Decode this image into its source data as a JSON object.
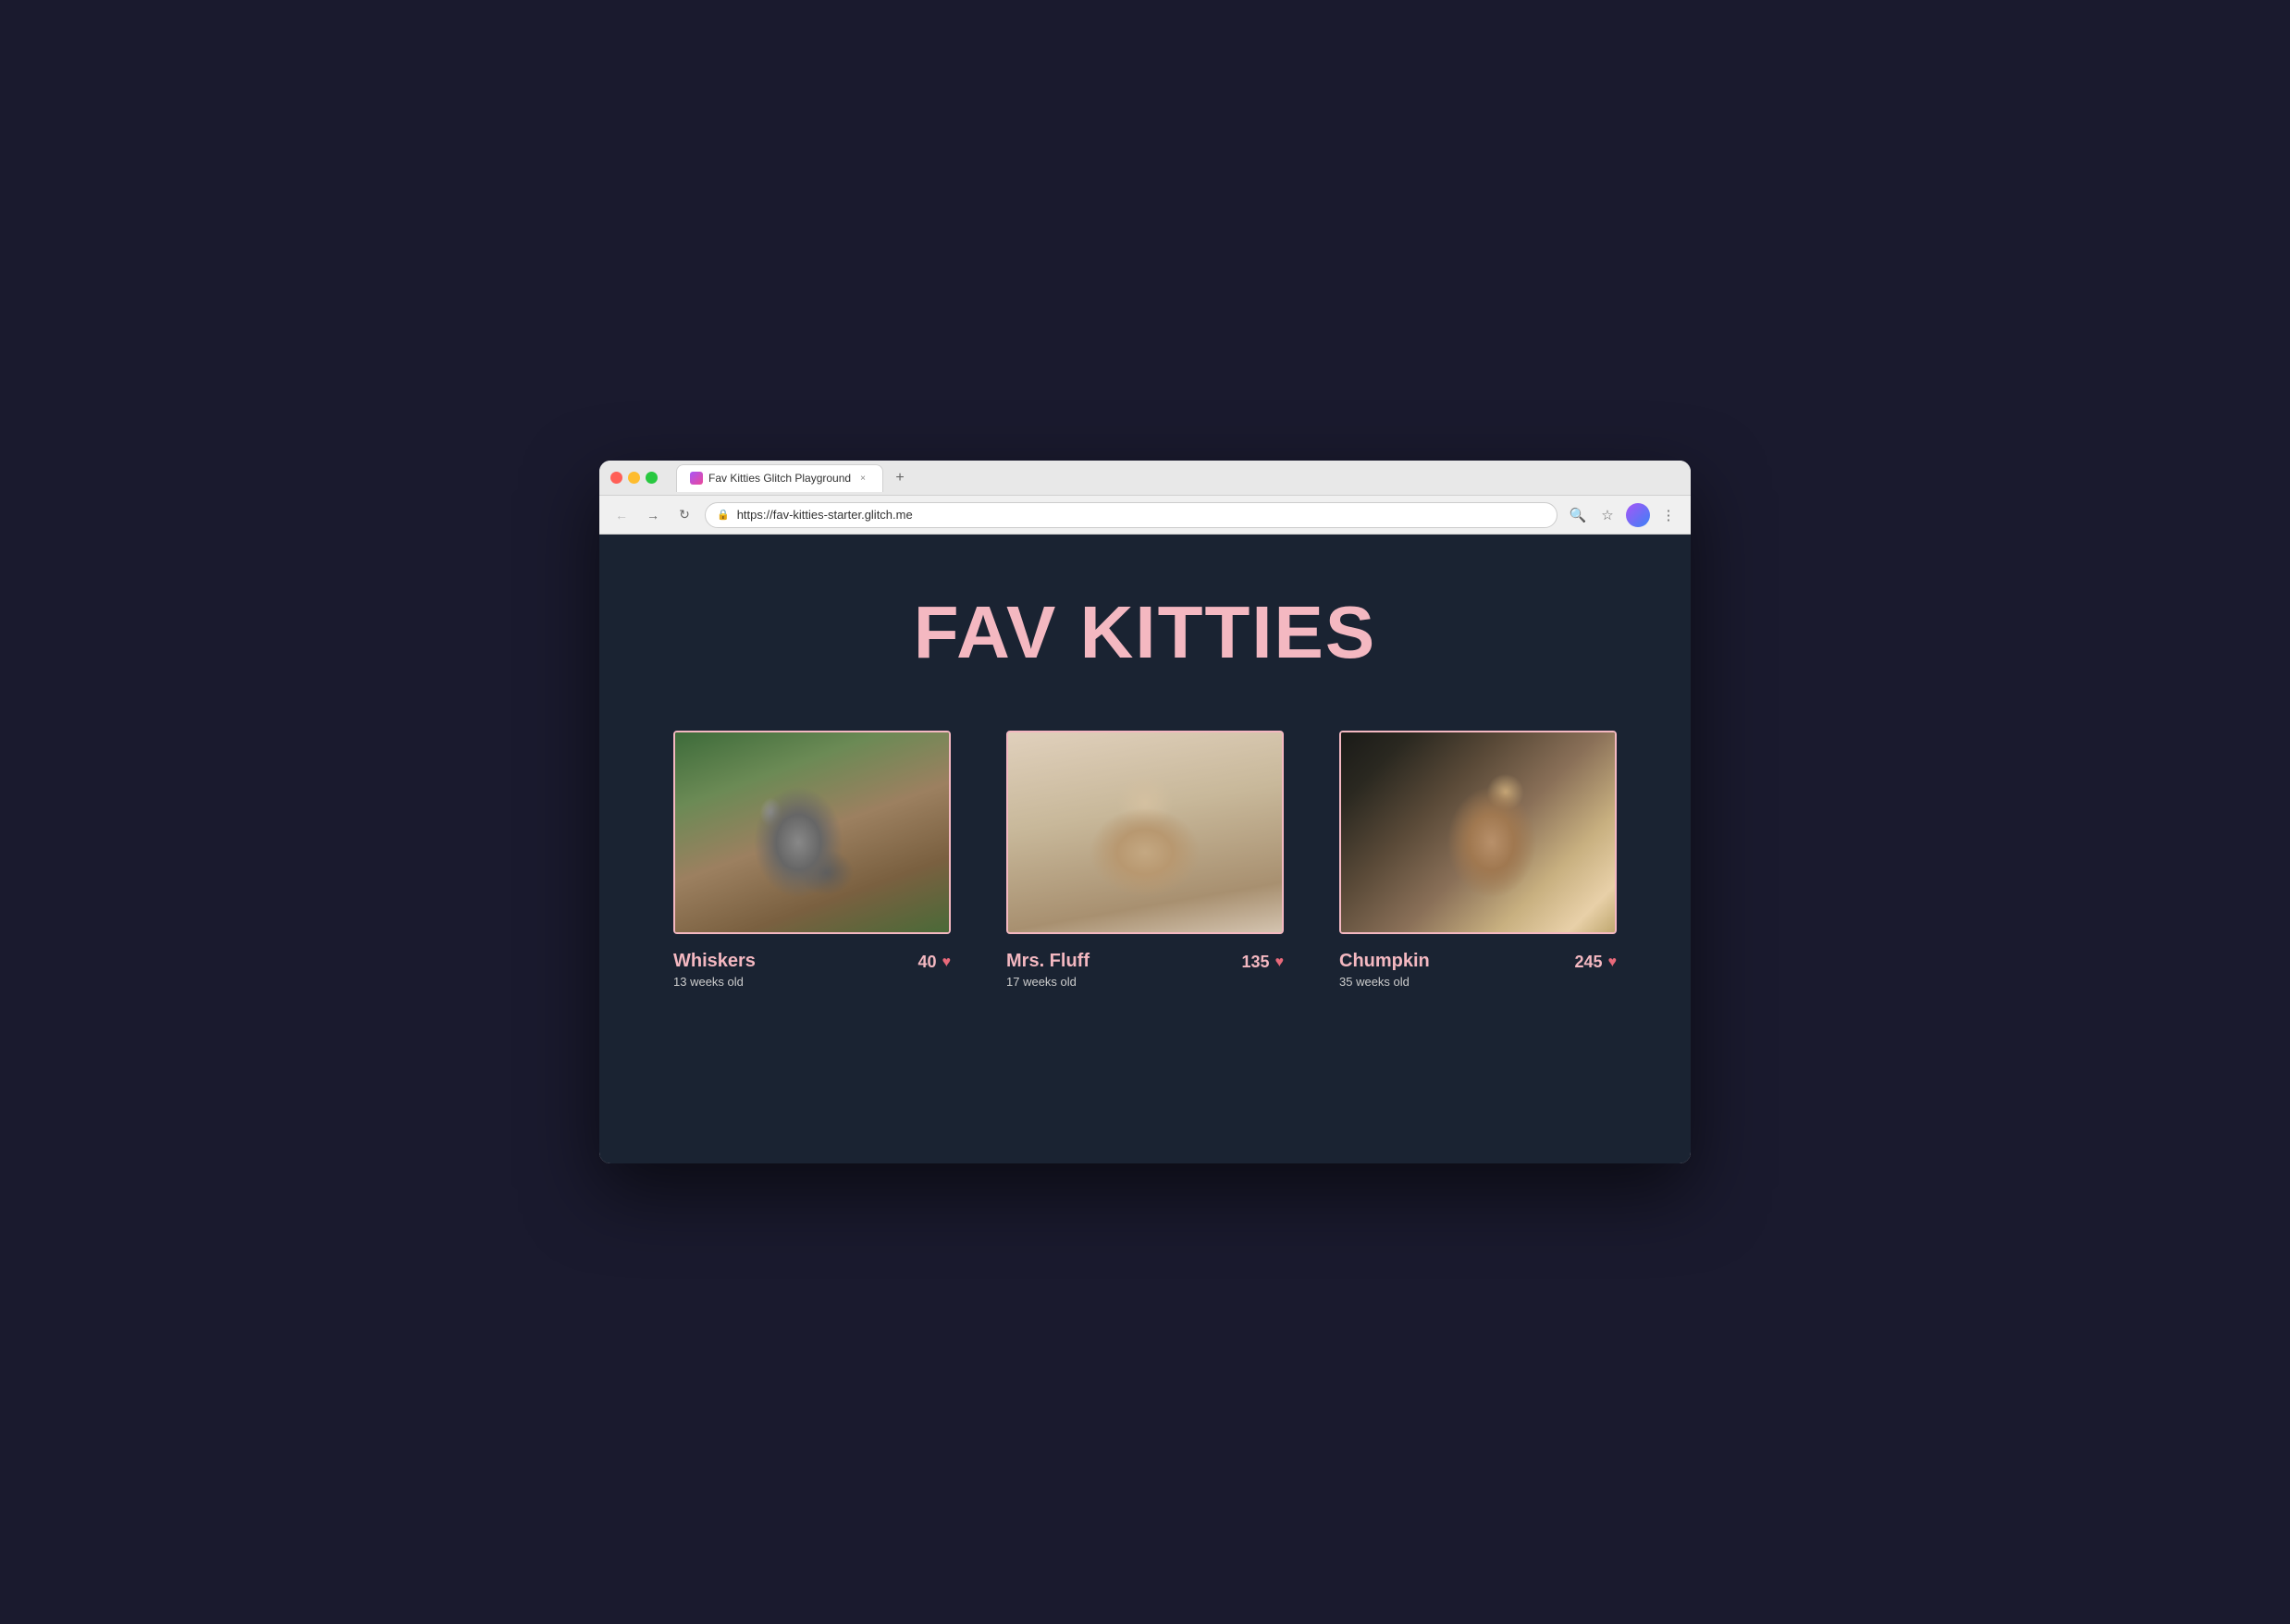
{
  "browser": {
    "tab_title": "Fav Kitties Glitch Playground",
    "tab_close": "×",
    "new_tab": "+",
    "url": "https://fav-kitties-starter.glitch.me",
    "nav": {
      "back": "←",
      "forward": "→",
      "refresh": "↻"
    },
    "toolbar": {
      "search": "🔍",
      "bookmark": "☆",
      "menu": "⋮"
    }
  },
  "page": {
    "title": "FAV KITTIES",
    "kitties": [
      {
        "id": "whiskers",
        "name": "Whiskers",
        "age": "13 weeks old",
        "votes": "40",
        "heart": "♥"
      },
      {
        "id": "mrs-fluff",
        "name": "Mrs. Fluff",
        "age": "17 weeks old",
        "votes": "135",
        "heart": "♥"
      },
      {
        "id": "chumpkin",
        "name": "Chumpkin",
        "age": "35 weeks old",
        "votes": "245",
        "heart": "♥"
      }
    ]
  },
  "colors": {
    "page_bg": "#1a2332",
    "title_color": "#f4b8c1",
    "card_border": "#f4b8c1",
    "name_color": "#f4b8c1",
    "age_color": "#cccccc",
    "vote_color": "#f4b8c1",
    "heart_color": "#e8697a"
  }
}
